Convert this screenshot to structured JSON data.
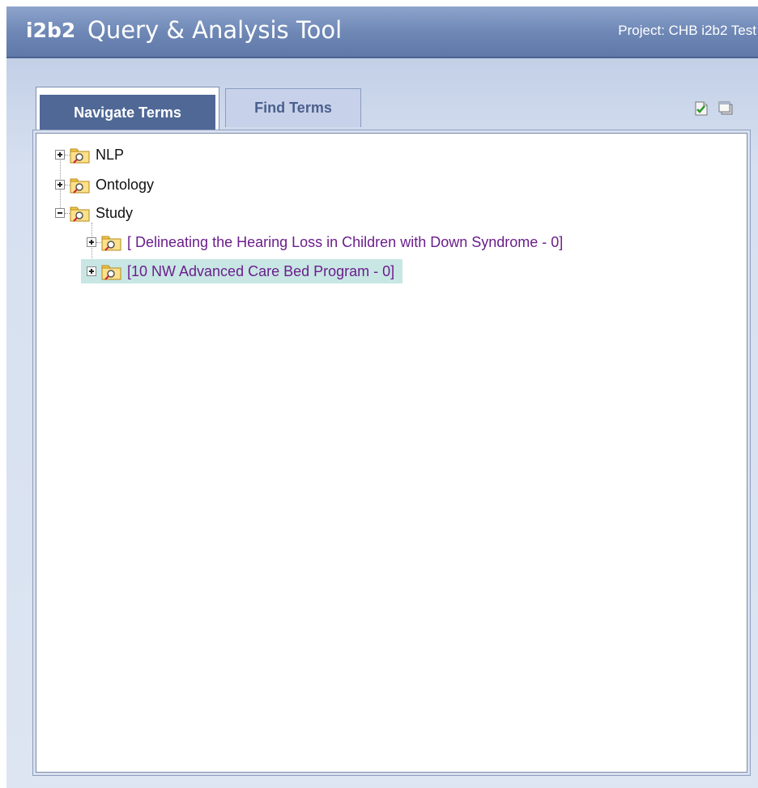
{
  "header": {
    "logo": "i2b2",
    "title": "Query & Analysis Tool",
    "project": "Project: CHB i2b2 Test"
  },
  "tabs": [
    {
      "label": "Navigate Terms",
      "active": true
    },
    {
      "label": "Find Terms",
      "active": false
    }
  ],
  "toolbar": {
    "icons": [
      "document-check-icon",
      "window-icon"
    ]
  },
  "tree": {
    "nodes": [
      {
        "label": "NLP",
        "expanded": false
      },
      {
        "label": "Ontology",
        "expanded": false
      },
      {
        "label": "Study",
        "expanded": true,
        "children": [
          {
            "label": "[ Delineating the Hearing Loss in Children with Down Syndrome - 0]",
            "expanded": false
          },
          {
            "label": "[10 NW Advanced Care Bed Program - 0]",
            "expanded": false,
            "selected": true
          }
        ]
      }
    ]
  },
  "colors": {
    "header": "#6f88b6",
    "active_tab": "#4f6896",
    "selected_row": "#c8e6e4",
    "child_label": "#6b1e8c"
  }
}
